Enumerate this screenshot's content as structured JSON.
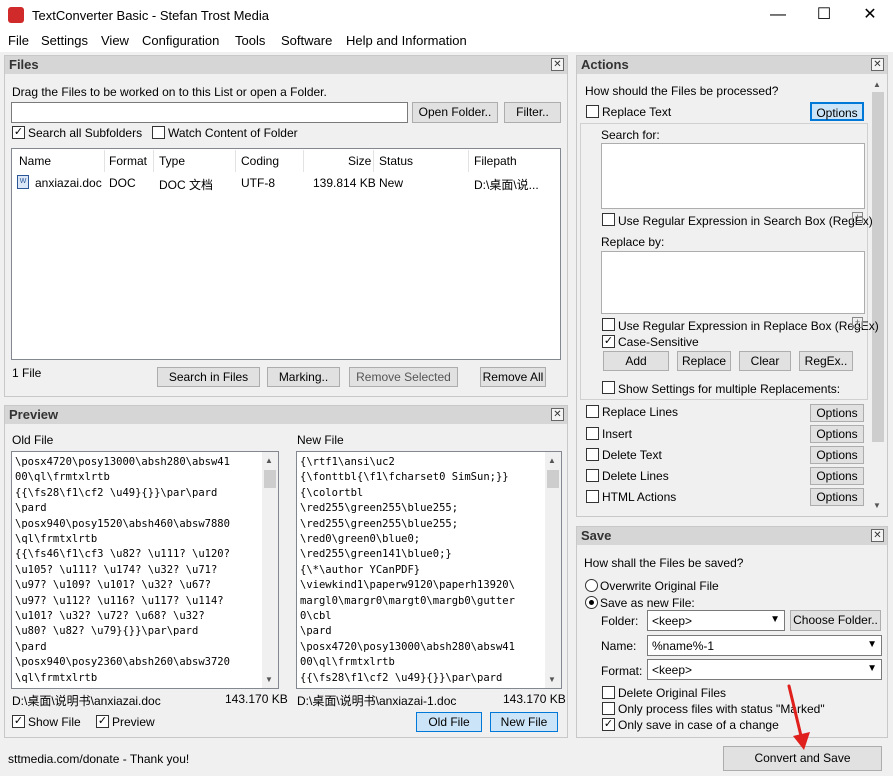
{
  "window": {
    "title": "TextConverter Basic - Stefan Trost Media",
    "minimize": "—",
    "maximize": "☐",
    "close": "✕"
  },
  "menu": [
    "File",
    "Settings",
    "View",
    "Configuration",
    "Tools",
    "Software",
    "Help and Information"
  ],
  "files_panel": {
    "title": "Files",
    "hint": "Drag the Files to be worked on to this List or open a Folder.",
    "open_folder": "Open Folder..",
    "filter": "Filter..",
    "search_subfolders": "Search all Subfolders",
    "watch_folder": "Watch Content of Folder",
    "columns": [
      "Name",
      "Format",
      "Type",
      "Coding",
      "Size",
      "Status",
      "Filepath"
    ],
    "rows": [
      {
        "name": "anxiazai.doc",
        "format": "DOC",
        "type": "DOC 文档",
        "coding": "UTF-8",
        "size": "139.814 KB",
        "status": "New",
        "filepath": "D:\\桌面\\说..."
      }
    ],
    "count": "1 File",
    "search_in_files": "Search in Files",
    "marking": "Marking..",
    "remove_selected": "Remove Selected",
    "remove_all": "Remove All"
  },
  "preview_panel": {
    "title": "Preview",
    "old_label": "Old File",
    "new_label": "New File",
    "old_text": "\\posx4720\\posy13000\\absh280\\absw41\n00\\ql\\frmtxlrtb\n{{\\fs28\\f1\\cf2 \\u49}{}}\\par\\pard\n\\pard\n\\posx940\\posy1520\\absh460\\absw7880\n\\ql\\frmtxlrtb\n{{\\fs46\\f1\\cf3 \\u82? \\u111? \\u120?\n\\u105? \\u111? \\u174? \\u32? \\u71?\n\\u97? \\u109? \\u101? \\u32? \\u67?\n\\u97? \\u112? \\u116? \\u117? \\u114?\n\\u101? \\u32? \\u72? \\u68? \\u32?\n\\u80? \\u82? \\u79}{}}\\par\\pard\n\\pard\n\\posx940\\posy2360\\absh260\\absw3720\n\\ql\\frmtxlrtb\n{{\\fs26\\f1\\cf2 \\u86? \\u101? \\u114?",
    "new_text": "{\\rtf1\\ansi\\uc2\n{\\fonttbl{\\f1\\fcharset0 SimSun;}}\n{\\colortbl\n\\red255\\green255\\blue255;\n\\red255\\green255\\blue255;\n\\red0\\green0\\blue0;\n\\red255\\green141\\blue0;}\n{\\*\\author YCanPDF}\n\\viewkind1\\paperw9120\\paperh13920\\\nmargl0\\margr0\\margt0\\margb0\\gutter\n0\\cbl\n\\pard\n\\posx4720\\posy13000\\absh280\\absw41\n00\\ql\\frmtxlrtb\n{{\\fs28\\f1\\cf2 \\u49}{}}\\par\\pard\n\\pard",
    "old_path": "D:\\桌面\\说明书\\anxiazai.doc",
    "old_size": "143.170 KB",
    "new_path": "D:\\桌面\\说明书\\anxiazai-1.doc",
    "new_size": "143.170 KB",
    "show_file": "Show File",
    "preview": "Preview",
    "old_file_btn": "Old File",
    "new_file_btn": "New File"
  },
  "actions_panel": {
    "title": "Actions",
    "question": "How should the Files be processed?",
    "replace_text": "Replace Text",
    "options": "Options",
    "search_for": "Search for:",
    "regex_search": "Use Regular Expression in Search Box (RegEx)",
    "replace_by": "Replace by:",
    "regex_replace": "Use Regular Expression in Replace Box (RegEx)",
    "case_sensitive": "Case-Sensitive",
    "add": "Add",
    "replace": "Replace",
    "clear": "Clear",
    "regex_btn": "RegEx..",
    "show_multi": "Show Settings for multiple Replacements:",
    "list": [
      "Replace Lines",
      "Insert",
      "Delete Text",
      "Delete Lines",
      "HTML Actions"
    ]
  },
  "save_panel": {
    "title": "Save",
    "question": "How shall the Files be saved?",
    "overwrite": "Overwrite Original File",
    "save_new": "Save as new File:",
    "folder_label": "Folder:",
    "folder_value": "<keep>",
    "choose_folder": "Choose Folder..",
    "name_label": "Name:",
    "name_value": "%name%-1",
    "format_label": "Format:",
    "format_value": "<keep>",
    "delete_original": "Delete Original Files",
    "only_marked": "Only process files with status \"Marked\"",
    "only_change": "Only save in case of a change"
  },
  "status": {
    "donate": "sttmedia.com/donate - Thank you!",
    "convert": "Convert and Save"
  },
  "colors": {
    "accent": "#0078d7",
    "arrow": "#e0201c"
  }
}
